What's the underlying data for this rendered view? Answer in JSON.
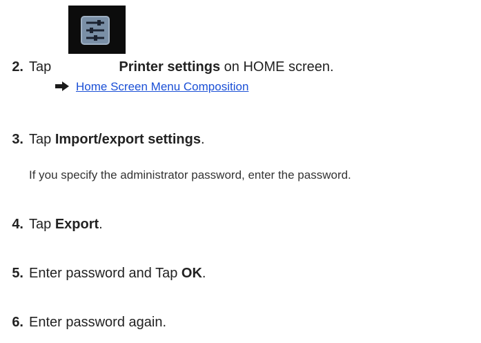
{
  "colors": {
    "text": "#222222",
    "link": "#1a4fd6",
    "icon_tile": "#0c0c0c",
    "icon_face": "#7a8fa6"
  },
  "steps": [
    {
      "number": "2.",
      "prefix": "Tap",
      "icon": "printer-settings-icon",
      "bold": "Printer settings",
      "suffix": "on HOME screen."
    },
    {
      "number": "3.",
      "prefix": "Tap",
      "bold": "Import/export settings",
      "suffix": "."
    },
    {
      "number": "4.",
      "prefix": "Tap",
      "bold": "Export",
      "suffix": "."
    },
    {
      "number": "5.",
      "prefix": "Enter password and Tap",
      "bold": "OK",
      "suffix": "."
    },
    {
      "number": "6.",
      "text": "Enter password again."
    }
  ],
  "reference_link": {
    "icon": "right-arrow-icon",
    "label": "Home Screen Menu Composition"
  },
  "note": "If you specify the administrator password, enter the password."
}
